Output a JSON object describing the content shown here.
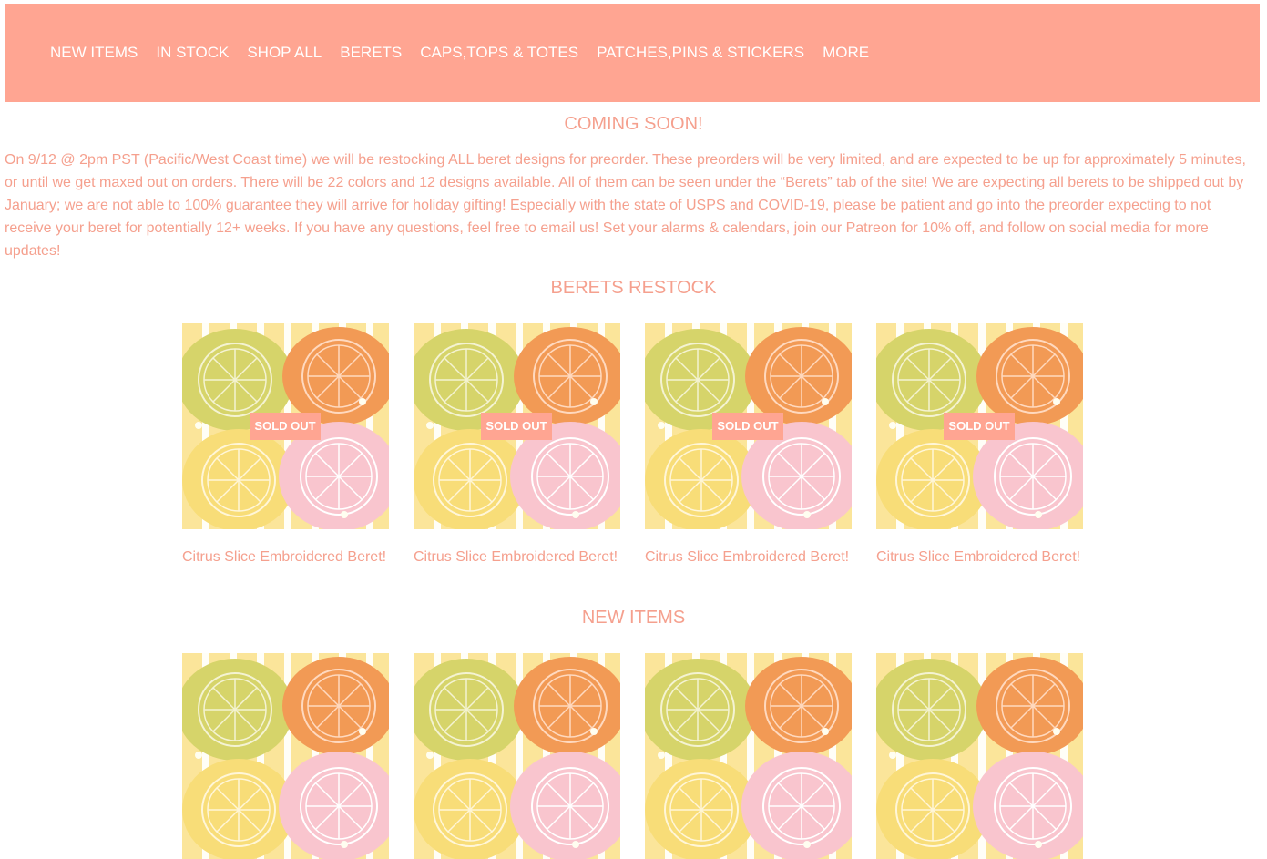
{
  "nav": {
    "items": [
      {
        "label": "NEW ITEMS"
      },
      {
        "label": "IN STOCK"
      },
      {
        "label": "SHOP ALL"
      },
      {
        "label": "BERETS"
      },
      {
        "label": "CAPS,TOPS & TOTES"
      },
      {
        "label": "PATCHES,PINS & STICKERS"
      },
      {
        "label": "MORE"
      }
    ]
  },
  "coming_soon": {
    "heading": "COMING SOON!",
    "text": "On 9/12 @ 2pm PST (Pacific/West Coast time) we will be restocking ALL beret designs for preorder. These preorders will be very limited, and are expected to be up for approximately 5 minutes, or until we get maxed out on orders. There will be 22 colors and 12 designs available. All of them can be seen under the “Berets” tab of the site! We are expecting all berets to be shipped out by January; we are not able to 100% guarantee they will arrive for holiday gifting! Especially with the state of USPS and COVID-19, please be patient and go into the preorder expecting to not receive your beret for potentially 12+ weeks. If you have any questions, feel free to email us! Set your alarms & calendars, join our Patreon for 10% off, and follow on social media for more updates!"
  },
  "restock": {
    "heading": "BERETS RESTOCK",
    "products": [
      {
        "title": "Citrus Slice Embroidered Beret!",
        "badge": "SOLD OUT"
      },
      {
        "title": "Citrus Slice Embroidered Beret!",
        "badge": "SOLD OUT"
      },
      {
        "title": "Citrus Slice Embroidered Beret!",
        "badge": "SOLD OUT"
      },
      {
        "title": "Citrus Slice Embroidered Beret!",
        "badge": "SOLD OUT"
      }
    ]
  },
  "new_items": {
    "heading": "NEW ITEMS"
  },
  "colors": {
    "brand": "#ffa592",
    "text": "#f5a08e"
  }
}
